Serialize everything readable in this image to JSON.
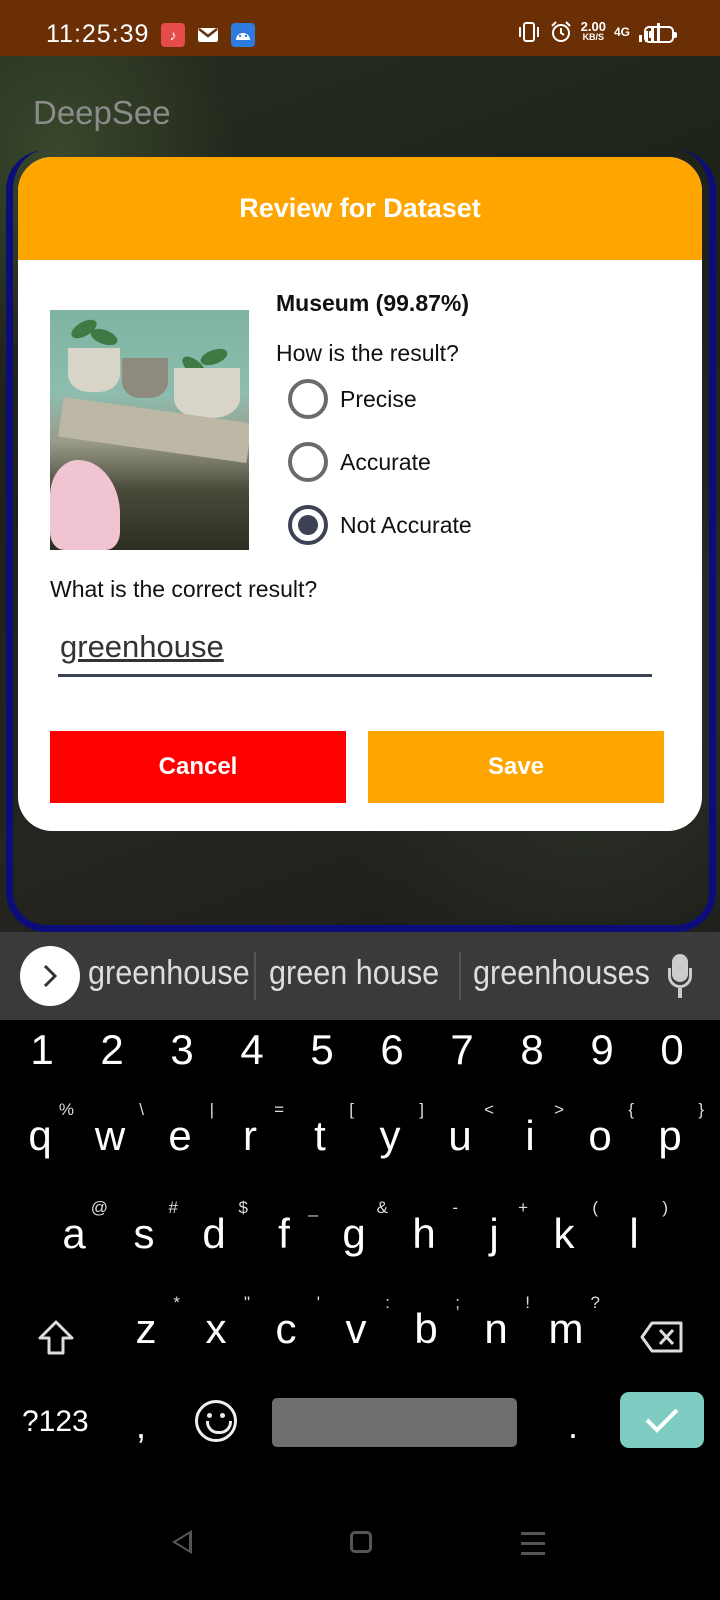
{
  "status_bar": {
    "time": "11:25:39",
    "net_speed": "2.00",
    "net_speed_unit": "KB/S",
    "network": "4G",
    "icons": [
      "music-app-icon",
      "gmail-icon",
      "android-icon",
      "vibrate-icon",
      "alarm-icon",
      "signal-icon",
      "battery-icon"
    ]
  },
  "app": {
    "title": "DeepSee"
  },
  "dialog": {
    "title": "Review for Dataset",
    "prediction": "Museum (99.87%)",
    "question": "How is the result?",
    "options": [
      {
        "label": "Precise",
        "checked": false
      },
      {
        "label": "Accurate",
        "checked": false
      },
      {
        "label": "Not Accurate",
        "checked": true
      }
    ],
    "correct_question": "What is the correct result?",
    "answer_value": "greenhouse",
    "cancel_label": "Cancel",
    "save_label": "Save",
    "colors": {
      "header": "#ffa500",
      "cancel": "#ff0000",
      "save": "#ffa500"
    }
  },
  "keyboard": {
    "suggestions": [
      "greenhouse",
      "green house",
      "greenhouses"
    ],
    "number_row": [
      "1",
      "2",
      "3",
      "4",
      "5",
      "6",
      "7",
      "8",
      "9",
      "0"
    ],
    "row1": [
      {
        "key": "q",
        "alt": "%"
      },
      {
        "key": "w",
        "alt": "\\"
      },
      {
        "key": "e",
        "alt": "|"
      },
      {
        "key": "r",
        "alt": "="
      },
      {
        "key": "t",
        "alt": "["
      },
      {
        "key": "y",
        "alt": "]"
      },
      {
        "key": "u",
        "alt": "<"
      },
      {
        "key": "i",
        "alt": ">"
      },
      {
        "key": "o",
        "alt": "{"
      },
      {
        "key": "p",
        "alt": "}"
      }
    ],
    "row2": [
      {
        "key": "a",
        "alt": "@"
      },
      {
        "key": "s",
        "alt": "#"
      },
      {
        "key": "d",
        "alt": "$"
      },
      {
        "key": "f",
        "alt": "_"
      },
      {
        "key": "g",
        "alt": "&"
      },
      {
        "key": "h",
        "alt": "-"
      },
      {
        "key": "j",
        "alt": "+"
      },
      {
        "key": "k",
        "alt": "("
      },
      {
        "key": "l",
        "alt": ")"
      }
    ],
    "row3": [
      {
        "key": "z",
        "alt": "*"
      },
      {
        "key": "x",
        "alt": "\""
      },
      {
        "key": "c",
        "alt": "'"
      },
      {
        "key": "v",
        "alt": ":"
      },
      {
        "key": "b",
        "alt": ";"
      },
      {
        "key": "n",
        "alt": "!"
      },
      {
        "key": "m",
        "alt": "?"
      }
    ],
    "symbols_label": "?123",
    "comma": ",",
    "period": ".",
    "enter_color": "#7fcdc2"
  }
}
